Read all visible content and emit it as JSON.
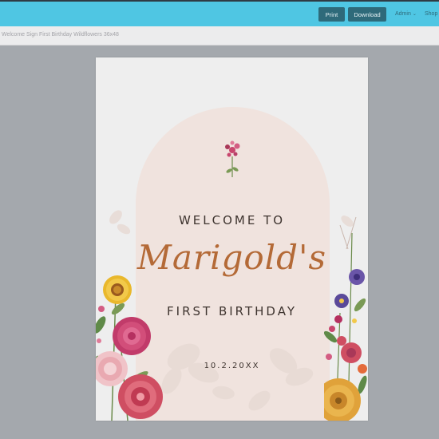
{
  "toolbar": {
    "print_label": "Print",
    "download_label": "Download",
    "admin_label": "Admin",
    "shop_label": "Shop"
  },
  "document": {
    "title": "Welcome Sign First Birthday Wildflowers 36x48"
  },
  "sign": {
    "welcome": "WELCOME TO",
    "name": "Marigold's",
    "subtitle": "FIRST BIRTHDAY",
    "date": "10.2.20XX"
  },
  "colors": {
    "topbar": "#4fc6e3",
    "button": "#2e6a7a",
    "arch": "#f0e3de",
    "name_script": "#b46a37",
    "text_dark": "#3e342f"
  }
}
